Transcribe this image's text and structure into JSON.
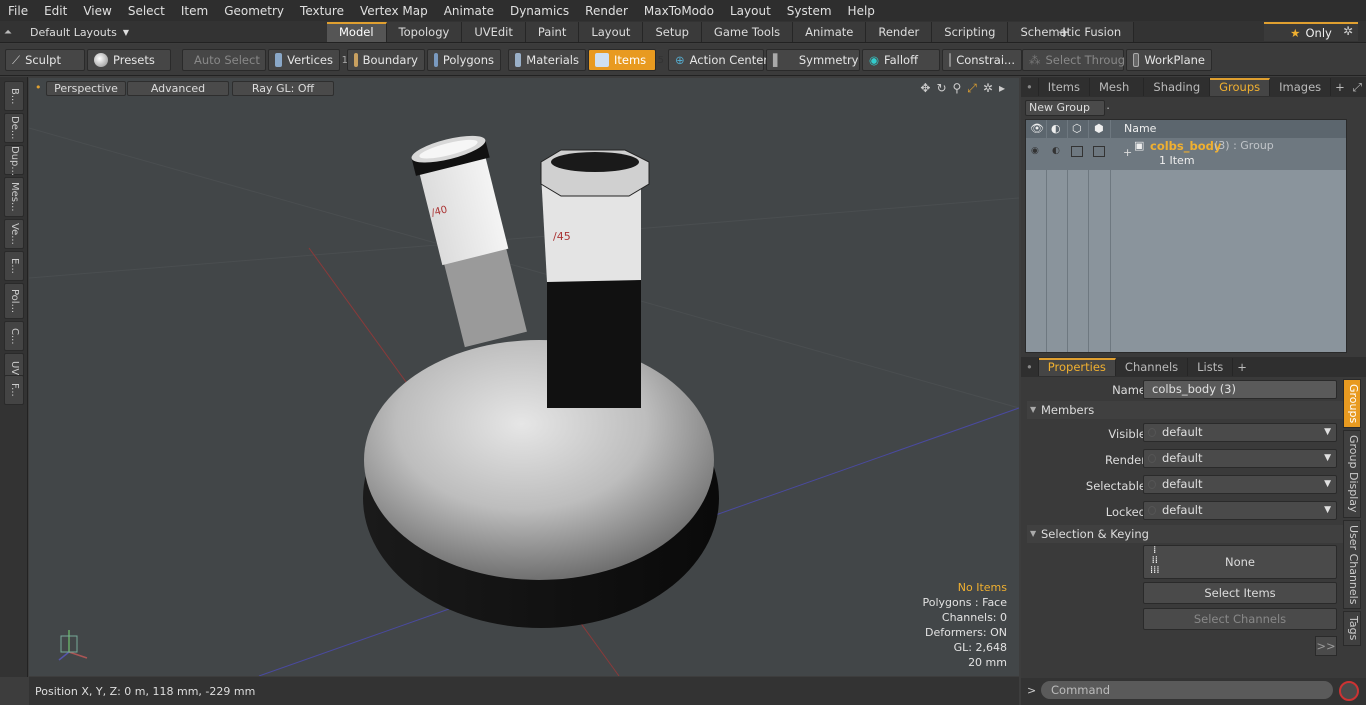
{
  "menu": [
    "File",
    "Edit",
    "View",
    "Select",
    "Item",
    "Geometry",
    "Texture",
    "Vertex Map",
    "Animate",
    "Dynamics",
    "Render",
    "MaxToModo",
    "Layout",
    "System",
    "Help"
  ],
  "layouts_label": "Default Layouts",
  "mode_tabs": [
    "Model",
    "Topology",
    "UVEdit",
    "Paint",
    "Layout",
    "Setup",
    "Game Tools",
    "Animate",
    "Render",
    "Scripting",
    "Schematic Fusion"
  ],
  "only_label": "Only",
  "toolbar": {
    "sculpt": "Sculpt",
    "presets": "Presets",
    "auto_select": "Auto Select",
    "vertices": "Vertices",
    "vertices_count": "1",
    "boundary": "Boundary",
    "polygons": "Polygons",
    "materials": "Materials",
    "items": "Items",
    "items_count": "5",
    "action_center": "Action Center",
    "symmetry": "Symmetry",
    "falloff": "Falloff",
    "constraints": "Constrai...",
    "select_through": "Select Through",
    "workplane": "WorkPlane"
  },
  "left_tabs": [
    "B...",
    "De...",
    "Dup...",
    "Mes...",
    "Ve...",
    "E...",
    "Pol...",
    "C...",
    "UV",
    "F..."
  ],
  "viewport": {
    "perspective": "Perspective",
    "advanced": "Advanced",
    "raygl": "Ray GL: Off",
    "stats": [
      "No Items",
      "Polygons : Face",
      "Channels: 0",
      "Deformers: ON",
      "GL: 2,648",
      "20 mm"
    ],
    "label_40": "/40",
    "label_45": "/45"
  },
  "status_position": "Position X, Y, Z:   0 m, 118 mm, -229 mm",
  "panel_tabs": [
    "Items",
    "Mesh ...",
    "Shading",
    "Groups",
    "Images"
  ],
  "new_group": "New Group",
  "group_list": {
    "name_header": "Name",
    "group_name": "colbs_body",
    "group_suffix": " (3) : Group",
    "group_sub": "1 Item"
  },
  "props_tabs": [
    "Properties",
    "Channels",
    "Lists"
  ],
  "props": {
    "name_label": "Name",
    "name_value": "colbs_body (3)",
    "members": "Members",
    "visible_label": "Visible",
    "visible_value": "default",
    "render_label": "Render",
    "render_value": "default",
    "selectable_label": "Selectable",
    "selectable_value": "default",
    "locked_label": "Locked",
    "locked_value": "default",
    "selection_keying": "Selection & Keying",
    "none": "None",
    "select_items": "Select Items",
    "select_channels": "Select Channels",
    "more": ">>"
  },
  "side_tabs": [
    "Groups",
    "Group Display",
    "User Channels",
    "Tags"
  ],
  "command_placeholder": "Command",
  "colors": {
    "accent": "#e89a20",
    "viewport_bg": "#424648"
  }
}
